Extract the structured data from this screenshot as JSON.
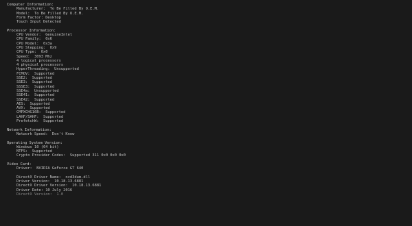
{
  "computer": {
    "title": "Computer Information:",
    "items": [
      "Manufacturer:  To Be Filled By O.E.M.",
      "Model:  To Be Filled By O.E.M.",
      "Form Factor: Desktop",
      "Touch Input Detected"
    ]
  },
  "processor": {
    "title": "Processor Information:",
    "items": [
      "CPU Vendor:  GenuineIntel",
      "CPU Family:  0x6",
      "CPU Model:  0x3a",
      "CPU Stepping:  0x9",
      "CPU Type:  0x0",
      "Speed:  3093 Mhz",
      "4 logical processors",
      "4 physical processors",
      "HyperThreading:  Unsupported",
      "FCMOV:  Supported",
      "SSE2:  Supported",
      "SSE3:  Supported",
      "SSSE3:  Supported",
      "SSE4a:  Unsupported",
      "SSE41:  Supported",
      "SSE42:  Supported",
      "AES:  Supported",
      "AVX:  Supported",
      "CMPXCHG16B:  Supported",
      "LAHF/SAHF:  Supported",
      "PrefetchW:  Supported"
    ]
  },
  "network": {
    "title": "Network Information:",
    "items": [
      "Network Speed:  Don't Know"
    ]
  },
  "os": {
    "title": "Operating System Version:",
    "items": [
      "Windows 10 (64 bit)",
      "NTFS:  Supported",
      "Crypto Provider Codes:  Supported 311 0x0 0x0 0x0"
    ]
  },
  "video": {
    "title": "Video Card:",
    "items": [
      "Driver:  NVIDIA GeForce GT 640"
    ],
    "items_after_gap": [
      "DirectX Driver Name:  nvd3dum.dll",
      "Driver Version:  10.18.13.6881",
      "DirectX Driver Version:  10.18.13.6881",
      "Driver Date: 10 July 2016",
      "DirectX Version:  1.0"
    ]
  }
}
